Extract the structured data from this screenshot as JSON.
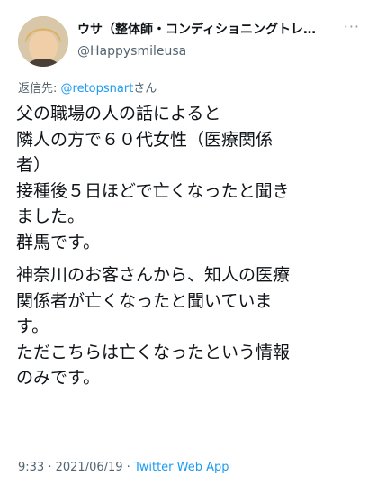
{
  "user": {
    "display_name": "ウサ（整体師・コンディショニングトレ…",
    "handle": "@Happysmileusa"
  },
  "menu_icon": "more-horizontal-icon",
  "reply": {
    "prefix": "返信先: ",
    "mention": "@retopsnart",
    "suffix": "さん"
  },
  "paragraphs": [
    [
      "父の職場の人の話によると",
      "隣人の方で６０代女性（医療関係",
      "者）",
      "接種後５日ほどで亡くなったと聞き",
      "ました。",
      "群馬です。"
    ],
    [
      "神奈川のお客さんから、知人の医療",
      "関係者が亡くなったと聞いていま",
      "す。",
      "ただこちらは亡くなったという情報",
      "のみです。"
    ]
  ],
  "meta": {
    "time": "9:33",
    "separator1": " · ",
    "date": "2021/06/19",
    "separator2": " · ",
    "app": "Twitter Web App"
  },
  "colors": {
    "text": "#0f1419",
    "secondary": "#536471",
    "accent": "#1d9bf0"
  }
}
